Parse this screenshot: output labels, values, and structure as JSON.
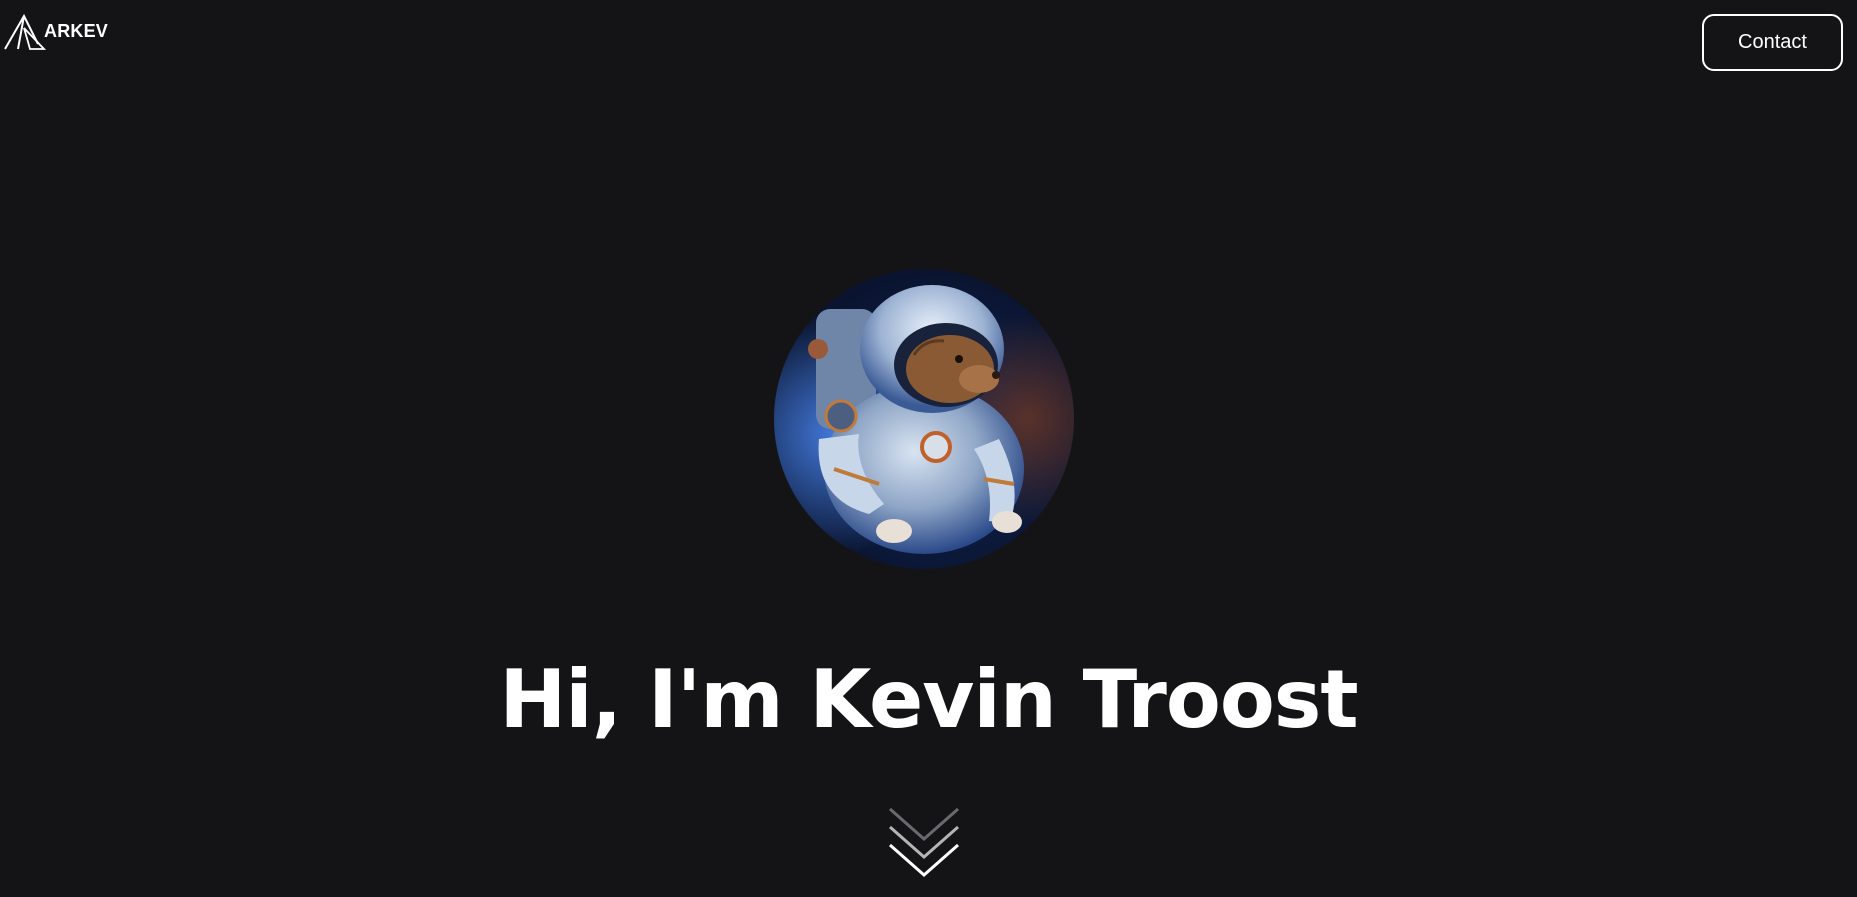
{
  "header": {
    "logo_text": "ARKEV",
    "logo_icon": "mountain-a-icon",
    "contact_label": "Contact"
  },
  "hero": {
    "avatar_icon": "astronaut-avatar",
    "title": "Hi, I'm Kevin Troost",
    "scroll_icon": "triple-chevron-down-icon"
  },
  "colors": {
    "background": "#141416",
    "text": "#ffffff",
    "button_border": "#ffffff"
  }
}
